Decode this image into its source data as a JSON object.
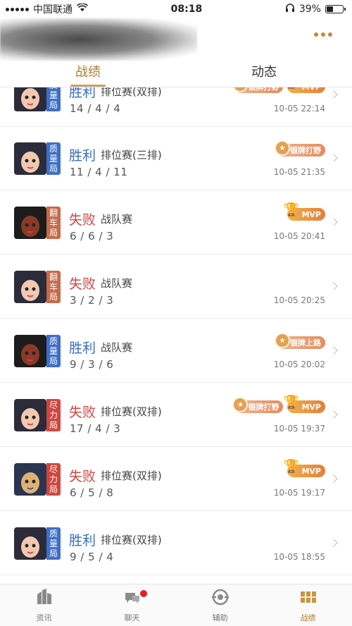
{
  "status_bar": {
    "carrier": "中国联通",
    "time": "08:18",
    "battery": "39%",
    "battery_fraction": 0.39
  },
  "tabs": [
    {
      "label": "战绩",
      "active": true
    },
    {
      "label": "动态",
      "active": false
    }
  ],
  "matches": [
    {
      "result": "胜利",
      "outcome": "win",
      "mode": "排位赛(双排)",
      "kda": "14 / 4 / 4",
      "time": "10-05 22:14",
      "tag": "质量局",
      "tag_color": "blue",
      "badges": [
        {
          "type": "silver",
          "label": "银牌打野"
        },
        {
          "type": "mvp",
          "label": "MVP"
        }
      ]
    },
    {
      "result": "胜利",
      "outcome": "win",
      "mode": "排位赛(三排)",
      "kda": "11 / 4 / 11",
      "time": "10-05 21:35",
      "tag": "质量局",
      "tag_color": "blue",
      "badges": [
        {
          "type": "silver",
          "label": "银牌打野"
        }
      ]
    },
    {
      "result": "失败",
      "outcome": "loss",
      "mode": "战队赛",
      "kda": "6 / 6 / 3",
      "time": "10-05 20:41",
      "tag": "翻车局",
      "tag_color": "brown",
      "badges": [
        {
          "type": "mvp",
          "label": "MVP"
        }
      ]
    },
    {
      "result": "失败",
      "outcome": "loss",
      "mode": "战队赛",
      "kda": "3 / 2 / 3",
      "time": "10-05 20:25",
      "tag": "翻车局",
      "tag_color": "brown",
      "badges": []
    },
    {
      "result": "胜利",
      "outcome": "win",
      "mode": "战队赛",
      "kda": "9 / 3 / 6",
      "time": "10-05 20:02",
      "tag": "质量局",
      "tag_color": "blue",
      "badges": [
        {
          "type": "silver",
          "label": "银牌上路"
        }
      ]
    },
    {
      "result": "失败",
      "outcome": "loss",
      "mode": "排位赛(双排)",
      "kda": "17 / 4 / 3",
      "time": "10-05 19:37",
      "tag": "尽力局",
      "tag_color": "red",
      "badges": [
        {
          "type": "silver",
          "label": "银牌打野"
        },
        {
          "type": "mvp",
          "label": "MVP"
        }
      ]
    },
    {
      "result": "失败",
      "outcome": "loss",
      "mode": "排位赛(双排)",
      "kda": "6 / 5 / 8",
      "time": "10-05 19:17",
      "tag": "尽力局",
      "tag_color": "red",
      "badges": [
        {
          "type": "mvp",
          "label": "MVP"
        }
      ]
    },
    {
      "result": "胜利",
      "outcome": "win",
      "mode": "排位赛(双排)",
      "kda": "9 / 5 / 4",
      "time": "10-05 18:55",
      "tag": "质量局",
      "tag_color": "blue",
      "badges": []
    }
  ],
  "bottom_nav": [
    {
      "label": "资讯",
      "icon": "news-icon",
      "active": false
    },
    {
      "label": "聊天",
      "icon": "chat-icon",
      "active": false,
      "has_dot": true
    },
    {
      "label": "辅助",
      "icon": "assist-icon",
      "active": false
    },
    {
      "label": "战绩",
      "icon": "record-icon",
      "active": true
    }
  ],
  "colors": {
    "accent": "#b07a30",
    "win": "#3a6cc5",
    "loss": "#d0463f"
  }
}
